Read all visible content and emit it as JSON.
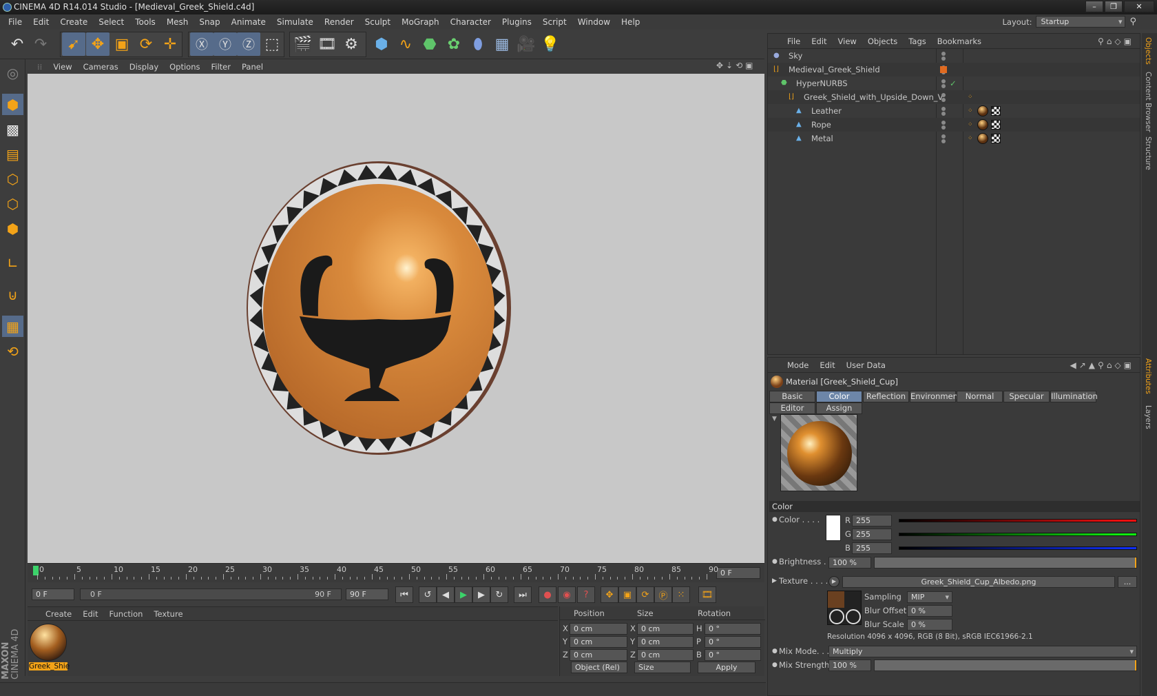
{
  "window": {
    "title": "CINEMA 4D R14.014 Studio - [Medieval_Greek_Shield.c4d]"
  },
  "menu": [
    "File",
    "Edit",
    "Create",
    "Select",
    "Tools",
    "Mesh",
    "Snap",
    "Animate",
    "Simulate",
    "Render",
    "Sculpt",
    "MoGraph",
    "Character",
    "Plugins",
    "Script",
    "Window",
    "Help"
  ],
  "layout": {
    "label": "Layout:",
    "value": "Startup"
  },
  "viewport": {
    "menu": [
      "View",
      "Cameras",
      "Display",
      "Options",
      "Filter",
      "Panel"
    ]
  },
  "timeline": {
    "ticks": [
      "0",
      "5",
      "10",
      "15",
      "20",
      "25",
      "30",
      "35",
      "40",
      "45",
      "50",
      "55",
      "60",
      "65",
      "70",
      "75",
      "80",
      "85",
      "90"
    ],
    "current": "0 F"
  },
  "transport": {
    "start": "0 F",
    "range_start": "0 F",
    "range_end": "90 F",
    "end": "90 F"
  },
  "material_manager": {
    "menu": [
      "Create",
      "Edit",
      "Function",
      "Texture"
    ],
    "material_label": "Greek_Shie"
  },
  "coordinates": {
    "headers": [
      "Position",
      "Size",
      "Rotation"
    ],
    "rows": [
      {
        "axis": "X",
        "pos": "0 cm",
        "size_axis": "X",
        "size": "0 cm",
        "rot_axis": "H",
        "rot": "0 °"
      },
      {
        "axis": "Y",
        "pos": "0 cm",
        "size_axis": "Y",
        "size": "0 cm",
        "rot_axis": "P",
        "rot": "0 °"
      },
      {
        "axis": "Z",
        "pos": "0 cm",
        "size_axis": "Z",
        "size": "0 cm",
        "rot_axis": "B",
        "rot": "0 °"
      }
    ],
    "mode": "Object (Rel)",
    "size_mode": "Size",
    "apply": "Apply"
  },
  "object_manager": {
    "menu": [
      "File",
      "Edit",
      "View",
      "Objects",
      "Tags",
      "Bookmarks"
    ],
    "objects": [
      {
        "name": "Sky",
        "indent": 0
      },
      {
        "name": "Medieval_Greek_Shield",
        "indent": 0
      },
      {
        "name": "HyperNURBS",
        "indent": 1
      },
      {
        "name": "Greek_Shield_with_Upside_Down_V",
        "indent": 2
      },
      {
        "name": "Leather",
        "indent": 3
      },
      {
        "name": "Rope",
        "indent": 3
      },
      {
        "name": "Metal",
        "indent": 3
      }
    ]
  },
  "attributes": {
    "menu": [
      "Mode",
      "Edit",
      "User Data"
    ],
    "material_title": "Material [Greek_Shield_Cup]",
    "tabs_row1": [
      "Basic",
      "Color",
      "Reflection",
      "Environment",
      "Normal",
      "Specular",
      "Illumination"
    ],
    "tabs_row2": [
      "Editor",
      "Assign"
    ],
    "section": "Color",
    "color_label": "Color . . . .",
    "r": "255",
    "g": "255",
    "b": "255",
    "r_label": "R",
    "g_label": "G",
    "b_label": "B",
    "brightness_label": "Brightness . .",
    "brightness": "100 %",
    "brightness_level": 1.0,
    "texture_label": "Texture . . . .",
    "texture_file": "Greek_Shield_Cup_Albedo.png",
    "texture_more": "...",
    "sampling_label": "Sampling",
    "sampling": "MIP",
    "blur_offset_label": "Blur Offset",
    "blur_offset": "0 %",
    "blur_scale_label": "Blur Scale",
    "blur_scale": "0 %",
    "resolution": "Resolution 4096 x 4096, RGB (8 Bit), sRGB IEC61966-2.1",
    "mix_mode_label": "Mix Mode. . .",
    "mix_mode": "Multiply",
    "mix_strength_label": "Mix Strength",
    "mix_strength": "100 %",
    "mix_strength_level": 1.0
  },
  "side_tabs": [
    "Objects",
    "Content Browser",
    "Structure",
    "Attributes",
    "Layers"
  ],
  "brand": {
    "line1": "MAXON",
    "line2": "CINEMA 4D"
  },
  "colors": {
    "accent": "#f3a318",
    "selected": "#6d86a8",
    "shield": "#d4873a"
  }
}
